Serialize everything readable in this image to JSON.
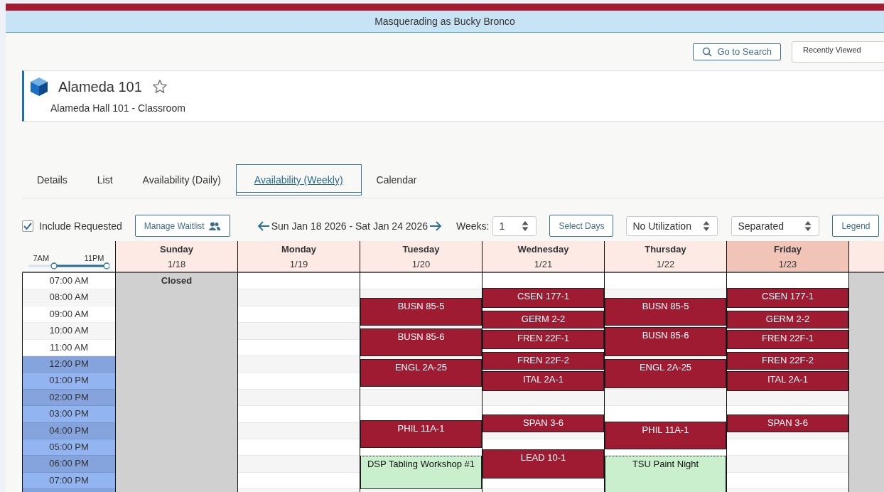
{
  "banner": {
    "text": "Masquerading as Bucky Bronco"
  },
  "header_actions": {
    "search_button": "Go to Search",
    "recently_viewed": {
      "placeholder": "Recently Viewed"
    }
  },
  "room": {
    "title": "Alameda 101",
    "favorite": false,
    "subtitle": "Alameda Hall 101 - Classroom"
  },
  "tabs": [
    {
      "label": "Details",
      "selected": false
    },
    {
      "label": "List",
      "selected": false
    },
    {
      "label": "Availability (Daily)",
      "selected": false
    },
    {
      "label": "Availability (Weekly)",
      "selected": true
    },
    {
      "label": "Calendar",
      "selected": false
    }
  ],
  "toolbar": {
    "include_requested": {
      "label": "Include Requested",
      "checked": true
    },
    "waitlist_button": "Manage Waitlist",
    "date_range": "Sun Jan 18 2026 - Sat Jan 24 2026",
    "weeks": {
      "label": "Weeks:",
      "value": "1"
    },
    "select_days_button": "Select Days",
    "utilization": {
      "value": "No Utilization"
    },
    "layout": {
      "value": "Separated"
    },
    "legend_button": "Legend"
  },
  "time_range": {
    "start_label": "7AM",
    "end_label": "11PM",
    "level": 0.65
  },
  "times": [
    {
      "label": "07:00 AM",
      "highlighted": false
    },
    {
      "label": "08:00 AM",
      "highlighted": false
    },
    {
      "label": "09:00 AM",
      "highlighted": false
    },
    {
      "label": "10:00 AM",
      "highlighted": false
    },
    {
      "label": "11:00 AM",
      "highlighted": false
    },
    {
      "label": "12:00 PM",
      "highlighted": true
    },
    {
      "label": "01:00 PM",
      "highlighted": true
    },
    {
      "label": "02:00 PM",
      "highlighted": true
    },
    {
      "label": "03:00 PM",
      "highlighted": true
    },
    {
      "label": "04:00 PM",
      "highlighted": true
    },
    {
      "label": "05:00 PM",
      "highlighted": true
    },
    {
      "label": "06:00 PM",
      "highlighted": true
    },
    {
      "label": "07:00 PM",
      "highlighted": true
    }
  ],
  "days": [
    {
      "name": "Sunday",
      "date": "1/18",
      "closed": true,
      "closed_label": "Closed",
      "selected": false
    },
    {
      "name": "Monday",
      "date": "1/19",
      "closed": false,
      "selected": false
    },
    {
      "name": "Tuesday",
      "date": "1/20",
      "closed": false,
      "selected": false,
      "events": [
        {
          "title": "BUSN 85-5",
          "kind": "class"
        },
        {
          "title": "BUSN 85-6",
          "kind": "class"
        },
        {
          "title": "ENGL 2A-25",
          "kind": "class"
        },
        {
          "title": "PHIL 11A-1",
          "kind": "class"
        },
        {
          "title": "DSP Tabling Workshop #1",
          "kind": "requested"
        }
      ]
    },
    {
      "name": "Wednesday",
      "date": "1/21",
      "closed": false,
      "selected": false,
      "events": [
        {
          "title": "CSEN 177-1",
          "kind": "class"
        },
        {
          "title": "GERM 2-2",
          "kind": "class"
        },
        {
          "title": "FREN 22F-1",
          "kind": "class"
        },
        {
          "title": "FREN 22F-2",
          "kind": "class"
        },
        {
          "title": "ITAL 2A-1",
          "kind": "class"
        },
        {
          "title": "SPAN 3-6",
          "kind": "class"
        },
        {
          "title": "LEAD 10-1",
          "kind": "class"
        }
      ]
    },
    {
      "name": "Thursday",
      "date": "1/22",
      "closed": false,
      "selected": false,
      "events": [
        {
          "title": "BUSN 85-5",
          "kind": "class"
        },
        {
          "title": "BUSN 85-6",
          "kind": "class"
        },
        {
          "title": "ENGL 2A-25",
          "kind": "class"
        },
        {
          "title": "PHIL 11A-1",
          "kind": "class"
        },
        {
          "title": "TSU Paint Night",
          "kind": "requested"
        }
      ]
    },
    {
      "name": "Friday",
      "date": "1/23",
      "closed": false,
      "selected": true,
      "events": [
        {
          "title": "CSEN 177-1",
          "kind": "class"
        },
        {
          "title": "GERM 2-2",
          "kind": "class"
        },
        {
          "title": "FREN 22F-1",
          "kind": "class"
        },
        {
          "title": "FREN 22F-2",
          "kind": "class"
        },
        {
          "title": "ITAL 2A-1",
          "kind": "class"
        },
        {
          "title": "SPAN 3-6",
          "kind": "class"
        }
      ]
    },
    {
      "closed": true,
      "selected": false
    }
  ]
}
